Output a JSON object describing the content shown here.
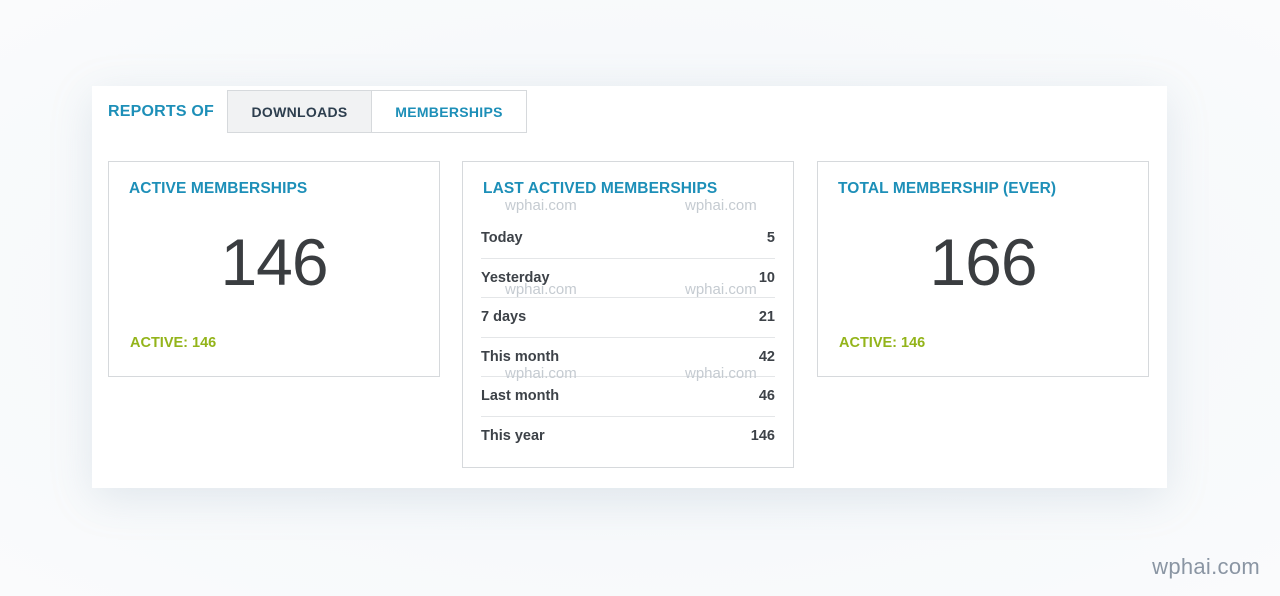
{
  "header": {
    "reports_label": "REPORTS OF",
    "tabs": [
      {
        "label": "DOWNLOADS"
      },
      {
        "label": "MEMBERSHIPS"
      }
    ]
  },
  "cards": {
    "active": {
      "title": "ACTIVE MEMBERSHIPS",
      "value": "146",
      "footer": "ACTIVE: 146"
    },
    "last": {
      "title": "LAST ACTIVED MEMBERSHIPS",
      "rows": [
        {
          "label": "Today",
          "value": "5"
        },
        {
          "label": "Yesterday",
          "value": "10"
        },
        {
          "label": "7 days",
          "value": "21"
        },
        {
          "label": "This month",
          "value": "42"
        },
        {
          "label": "Last month",
          "value": "46"
        },
        {
          "label": "This year",
          "value": "146"
        }
      ]
    },
    "total": {
      "title": "TOTAL MEMBERSHIP (EVER)",
      "value": "166",
      "footer": "ACTIVE: 146"
    }
  },
  "watermark": {
    "text": "wphai.com"
  },
  "colors": {
    "accent": "#1d8fb8",
    "active_green": "#93b41a",
    "number_dark": "#3a3d40"
  }
}
